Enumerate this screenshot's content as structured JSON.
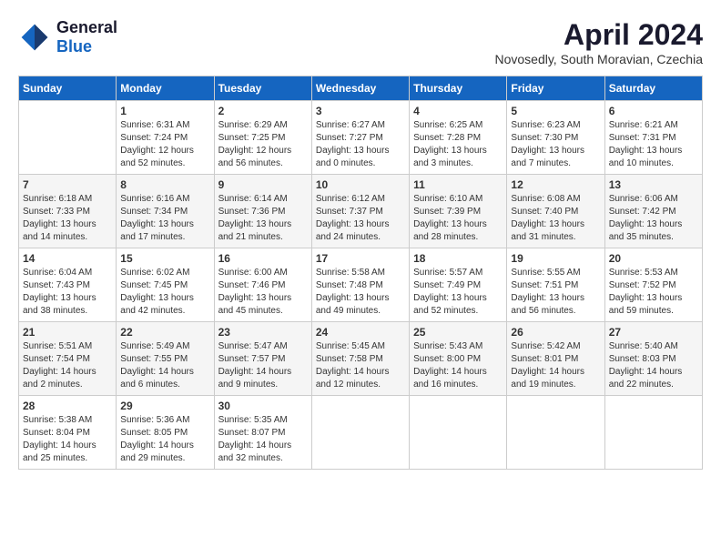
{
  "header": {
    "logo_general": "General",
    "logo_blue": "Blue",
    "month_title": "April 2024",
    "location": "Novosedly, South Moravian, Czechia"
  },
  "days_of_week": [
    "Sunday",
    "Monday",
    "Tuesday",
    "Wednesday",
    "Thursday",
    "Friday",
    "Saturday"
  ],
  "weeks": [
    [
      {
        "day": "",
        "sunrise": "",
        "sunset": "",
        "daylight": ""
      },
      {
        "day": "1",
        "sunrise": "Sunrise: 6:31 AM",
        "sunset": "Sunset: 7:24 PM",
        "daylight": "Daylight: 12 hours and 52 minutes."
      },
      {
        "day": "2",
        "sunrise": "Sunrise: 6:29 AM",
        "sunset": "Sunset: 7:25 PM",
        "daylight": "Daylight: 12 hours and 56 minutes."
      },
      {
        "day": "3",
        "sunrise": "Sunrise: 6:27 AM",
        "sunset": "Sunset: 7:27 PM",
        "daylight": "Daylight: 13 hours and 0 minutes."
      },
      {
        "day": "4",
        "sunrise": "Sunrise: 6:25 AM",
        "sunset": "Sunset: 7:28 PM",
        "daylight": "Daylight: 13 hours and 3 minutes."
      },
      {
        "day": "5",
        "sunrise": "Sunrise: 6:23 AM",
        "sunset": "Sunset: 7:30 PM",
        "daylight": "Daylight: 13 hours and 7 minutes."
      },
      {
        "day": "6",
        "sunrise": "Sunrise: 6:21 AM",
        "sunset": "Sunset: 7:31 PM",
        "daylight": "Daylight: 13 hours and 10 minutes."
      }
    ],
    [
      {
        "day": "7",
        "sunrise": "Sunrise: 6:18 AM",
        "sunset": "Sunset: 7:33 PM",
        "daylight": "Daylight: 13 hours and 14 minutes."
      },
      {
        "day": "8",
        "sunrise": "Sunrise: 6:16 AM",
        "sunset": "Sunset: 7:34 PM",
        "daylight": "Daylight: 13 hours and 17 minutes."
      },
      {
        "day": "9",
        "sunrise": "Sunrise: 6:14 AM",
        "sunset": "Sunset: 7:36 PM",
        "daylight": "Daylight: 13 hours and 21 minutes."
      },
      {
        "day": "10",
        "sunrise": "Sunrise: 6:12 AM",
        "sunset": "Sunset: 7:37 PM",
        "daylight": "Daylight: 13 hours and 24 minutes."
      },
      {
        "day": "11",
        "sunrise": "Sunrise: 6:10 AM",
        "sunset": "Sunset: 7:39 PM",
        "daylight": "Daylight: 13 hours and 28 minutes."
      },
      {
        "day": "12",
        "sunrise": "Sunrise: 6:08 AM",
        "sunset": "Sunset: 7:40 PM",
        "daylight": "Daylight: 13 hours and 31 minutes."
      },
      {
        "day": "13",
        "sunrise": "Sunrise: 6:06 AM",
        "sunset": "Sunset: 7:42 PM",
        "daylight": "Daylight: 13 hours and 35 minutes."
      }
    ],
    [
      {
        "day": "14",
        "sunrise": "Sunrise: 6:04 AM",
        "sunset": "Sunset: 7:43 PM",
        "daylight": "Daylight: 13 hours and 38 minutes."
      },
      {
        "day": "15",
        "sunrise": "Sunrise: 6:02 AM",
        "sunset": "Sunset: 7:45 PM",
        "daylight": "Daylight: 13 hours and 42 minutes."
      },
      {
        "day": "16",
        "sunrise": "Sunrise: 6:00 AM",
        "sunset": "Sunset: 7:46 PM",
        "daylight": "Daylight: 13 hours and 45 minutes."
      },
      {
        "day": "17",
        "sunrise": "Sunrise: 5:58 AM",
        "sunset": "Sunset: 7:48 PM",
        "daylight": "Daylight: 13 hours and 49 minutes."
      },
      {
        "day": "18",
        "sunrise": "Sunrise: 5:57 AM",
        "sunset": "Sunset: 7:49 PM",
        "daylight": "Daylight: 13 hours and 52 minutes."
      },
      {
        "day": "19",
        "sunrise": "Sunrise: 5:55 AM",
        "sunset": "Sunset: 7:51 PM",
        "daylight": "Daylight: 13 hours and 56 minutes."
      },
      {
        "day": "20",
        "sunrise": "Sunrise: 5:53 AM",
        "sunset": "Sunset: 7:52 PM",
        "daylight": "Daylight: 13 hours and 59 minutes."
      }
    ],
    [
      {
        "day": "21",
        "sunrise": "Sunrise: 5:51 AM",
        "sunset": "Sunset: 7:54 PM",
        "daylight": "Daylight: 14 hours and 2 minutes."
      },
      {
        "day": "22",
        "sunrise": "Sunrise: 5:49 AM",
        "sunset": "Sunset: 7:55 PM",
        "daylight": "Daylight: 14 hours and 6 minutes."
      },
      {
        "day": "23",
        "sunrise": "Sunrise: 5:47 AM",
        "sunset": "Sunset: 7:57 PM",
        "daylight": "Daylight: 14 hours and 9 minutes."
      },
      {
        "day": "24",
        "sunrise": "Sunrise: 5:45 AM",
        "sunset": "Sunset: 7:58 PM",
        "daylight": "Daylight: 14 hours and 12 minutes."
      },
      {
        "day": "25",
        "sunrise": "Sunrise: 5:43 AM",
        "sunset": "Sunset: 8:00 PM",
        "daylight": "Daylight: 14 hours and 16 minutes."
      },
      {
        "day": "26",
        "sunrise": "Sunrise: 5:42 AM",
        "sunset": "Sunset: 8:01 PM",
        "daylight": "Daylight: 14 hours and 19 minutes."
      },
      {
        "day": "27",
        "sunrise": "Sunrise: 5:40 AM",
        "sunset": "Sunset: 8:03 PM",
        "daylight": "Daylight: 14 hours and 22 minutes."
      }
    ],
    [
      {
        "day": "28",
        "sunrise": "Sunrise: 5:38 AM",
        "sunset": "Sunset: 8:04 PM",
        "daylight": "Daylight: 14 hours and 25 minutes."
      },
      {
        "day": "29",
        "sunrise": "Sunrise: 5:36 AM",
        "sunset": "Sunset: 8:05 PM",
        "daylight": "Daylight: 14 hours and 29 minutes."
      },
      {
        "day": "30",
        "sunrise": "Sunrise: 5:35 AM",
        "sunset": "Sunset: 8:07 PM",
        "daylight": "Daylight: 14 hours and 32 minutes."
      },
      {
        "day": "",
        "sunrise": "",
        "sunset": "",
        "daylight": ""
      },
      {
        "day": "",
        "sunrise": "",
        "sunset": "",
        "daylight": ""
      },
      {
        "day": "",
        "sunrise": "",
        "sunset": "",
        "daylight": ""
      },
      {
        "day": "",
        "sunrise": "",
        "sunset": "",
        "daylight": ""
      }
    ]
  ]
}
